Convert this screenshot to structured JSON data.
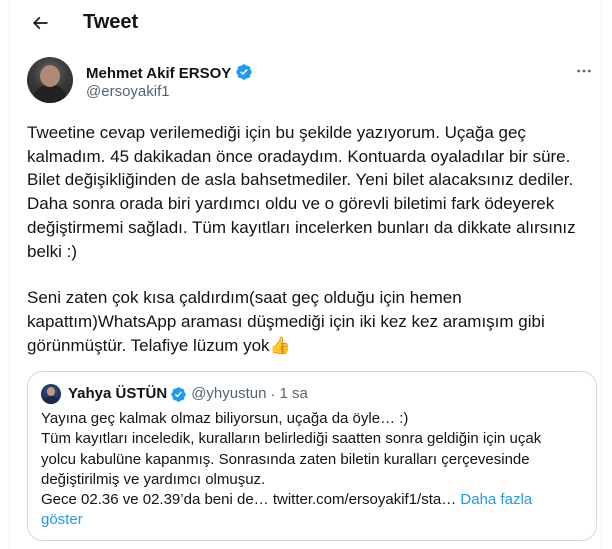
{
  "header": {
    "title": "Tweet"
  },
  "author": {
    "name": "Mehmet Akif ERSOY",
    "handle": "@ersoyakif1"
  },
  "tweet": {
    "paragraph1": "Tweetine cevap verilemediği için bu şekilde yazıyorum. Uçağa geç\nkalmadım. 45 dakikadan önce oradaydım. Kontuarda oyaladılar bir süre.\nBilet değişikliğinden de asla bahsetmediler. Yeni bilet alacaksınız dediler.\nDaha sonra orada biri yardımcı oldu ve o görevli biletimi fark ödeyerek\ndeğiştirmemi sağladı. Tüm kayıtları incelerken bunları da dikkate alırsınız\nbelki :)",
    "paragraph2": "Seni zaten çok kısa çaldırdım(saat geç olduğu için hemen\nkapattım)WhatsApp araması düşmediği için iki kez kez aramışım gibi\ngörünmüştür. Telafiye lüzum yok👍"
  },
  "quoted_tweet": {
    "name": "Yahya ÜSTÜN",
    "handle": "@yhyustun",
    "separator": "·",
    "time": "1 sa",
    "line1": "Yayına geç kalmak olmaz biliyorsun, uçağa da öyle… :)",
    "line2": "Tüm kayıtları inceledik, kuralların belirlediği saatten sonra geldiğin için uçak",
    "line3": "yolcu kabulüne kapanmış. Sonrasında zaten biletin kuralları çerçevesinde",
    "line4": "değiştirilmiş ve yardımcı olmuşuz.",
    "line5": "Gece 02.36 ve 02.39’da beni de… twitter.com/ersoyakif1/sta…",
    "show_more": "Daha fazla",
    "show_more_2": "göster"
  },
  "icons": {
    "back": "arrow-left-icon",
    "verified": "verified-badge-icon",
    "more": "more-horizontal-icon"
  },
  "colors": {
    "accent": "#1d9bf0",
    "text": "#0f1419",
    "secondary": "#536471",
    "border": "#cfd9de"
  }
}
